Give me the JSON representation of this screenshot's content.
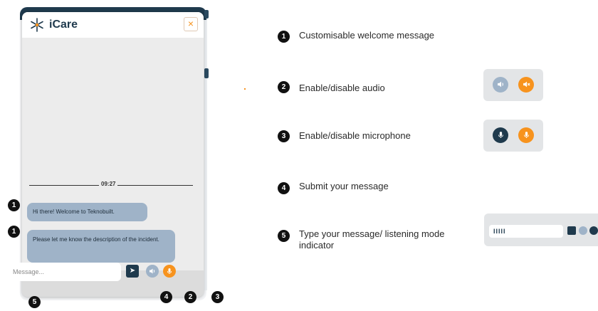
{
  "widget": {
    "brand": "iCare",
    "close_label": "×",
    "time": "09:27",
    "messages": [
      "Hi there! Welcome to Teknobuilt.",
      "Please let me know the description of the incident."
    ],
    "input_placeholder": "Message...",
    "send_label": "➤"
  },
  "features": [
    {
      "number": "1",
      "text": "Customisable welcome message"
    },
    {
      "number": "2",
      "text": "Enable/disable audio"
    },
    {
      "number": "3",
      "text": "Enable/disable microphone"
    },
    {
      "number": "4",
      "text": "Submit your message"
    },
    {
      "number": "5",
      "text": "Type your message/ listening mode indicator"
    }
  ],
  "callouts": [
    "1",
    "1",
    "4",
    "2",
    "3",
    "5"
  ],
  "listening_indicator": "IIIII",
  "colors": {
    "navy": "#1f3a4d",
    "orange": "#f7931e",
    "bubble": "#9fb3c8"
  },
  "icons": [
    "snowflake-logo-icon",
    "close-icon",
    "send-icon",
    "speaker-icon",
    "speaker-muted-icon",
    "microphone-icon"
  ]
}
